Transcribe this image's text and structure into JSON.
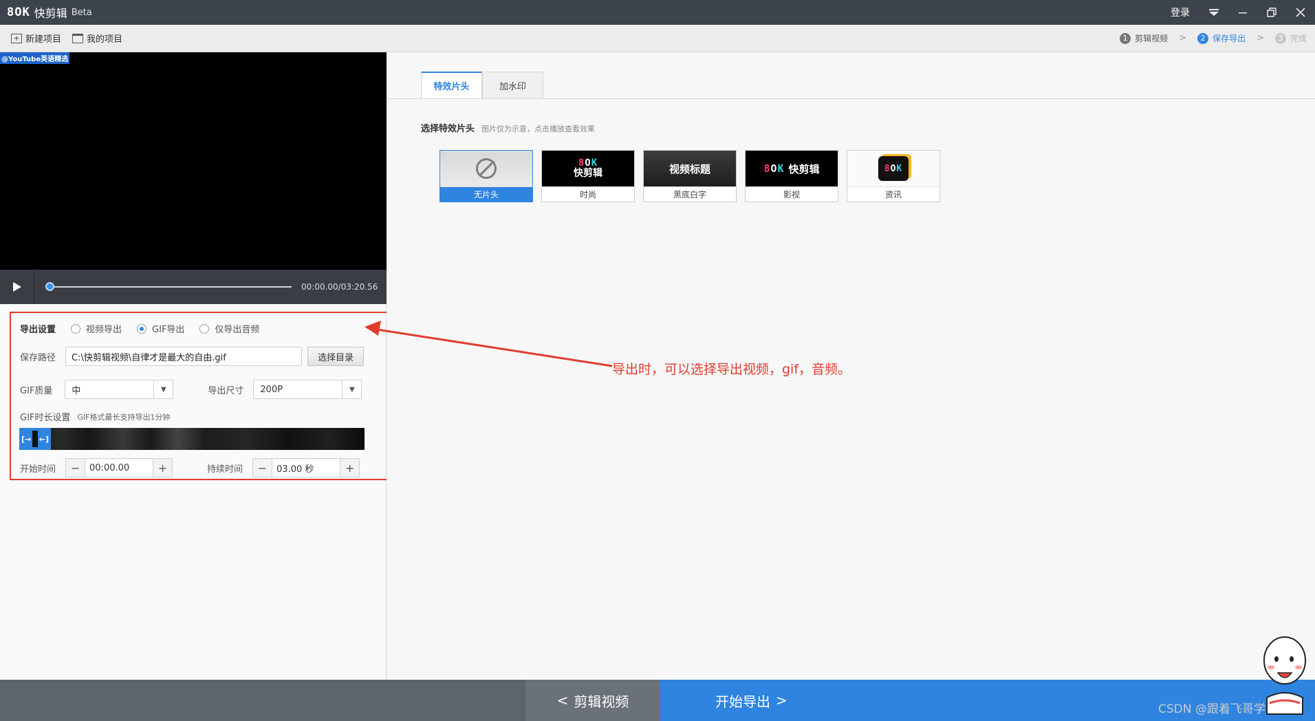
{
  "app": {
    "logo_mark": "8OK",
    "title": "快剪辑",
    "beta": "Beta",
    "login": "登录",
    "icons": {
      "menu": "triangle-down-icon",
      "min": "minimize-icon",
      "max": "restore-icon",
      "close": "close-icon"
    }
  },
  "toolbar": {
    "new_project": "新建项目",
    "my_projects": "我的项目",
    "steps": [
      {
        "num": "1",
        "label": "剪辑视频"
      },
      {
        "num": "2",
        "label": "保存导出"
      },
      {
        "num": "3",
        "label": "完成"
      }
    ],
    "sep": ">"
  },
  "video": {
    "tag": "@YouTube英语精选",
    "time": "00:00.00/03:20.56",
    "progress": 0.0
  },
  "export": {
    "title": "导出设置",
    "options": [
      "视频导出",
      "GIF导出",
      "仅导出音频"
    ],
    "selected_option": "GIF导出",
    "path_label": "保存路径",
    "path_value": "C:\\快剪辑视频\\自律才是最大的自由.gif",
    "choose_dir": "选择目录",
    "quality_label": "GIF质量",
    "quality_value": "中",
    "size_label": "导出尺寸",
    "size_value": "200P",
    "duration_label": "GIF时长设置",
    "duration_hint": "GIF格式最长支持导出1分钟",
    "start_label": "开始时间",
    "start_value": "00:00.00",
    "length_label": "持续时间",
    "length_value": "03.00 秒",
    "minus": "−",
    "plus": "+"
  },
  "right": {
    "tabs": [
      "特效片头",
      "加水印"
    ],
    "section_title": "选择特效片头",
    "section_hint": "图片仅为示意，点击播放查看效果",
    "intros": [
      {
        "caption": "无片头"
      },
      {
        "caption": "时尚",
        "thumb_text": "快剪辑"
      },
      {
        "caption": "黑底白字",
        "thumb_text": "视频标题"
      },
      {
        "caption": "影视",
        "thumb_text": "快剪辑"
      },
      {
        "caption": "资讯"
      }
    ]
  },
  "annotation": {
    "text": "导出时，可以选择导出视频，gif，音频。",
    "color": "#e23b2e"
  },
  "bottom": {
    "prev": "剪辑视频",
    "next": "开始导出",
    "watermark": "CSDN @跟着飞哥学编程"
  },
  "colors": {
    "accent": "#2f84e0",
    "titlebar": "#3d434c",
    "annotation": "#e23b2e"
  }
}
